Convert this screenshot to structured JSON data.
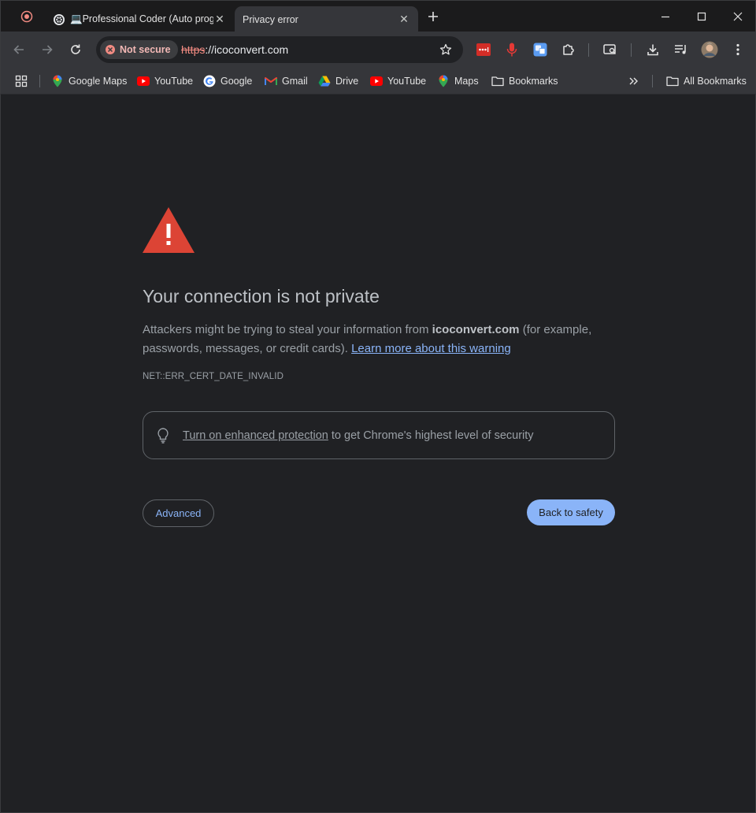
{
  "tabs": [
    {
      "title": "💻Professional Coder (Auto programming)",
      "favicon": "chatgpt-icon",
      "active": false
    },
    {
      "title": "Privacy error",
      "favicon": "",
      "active": true
    }
  ],
  "omnibox": {
    "security_chip": "Not secure",
    "url_scheme": "https",
    "url_rest": "://icoconvert.com"
  },
  "bookmarks": [
    {
      "label": "Google Maps",
      "icon": "maps-pin-icon"
    },
    {
      "label": "YouTube",
      "icon": "youtube-icon"
    },
    {
      "label": "Google",
      "icon": "google-icon"
    },
    {
      "label": "Gmail",
      "icon": "gmail-icon"
    },
    {
      "label": "Drive",
      "icon": "drive-icon"
    },
    {
      "label": "YouTube",
      "icon": "youtube-icon"
    },
    {
      "label": "Maps",
      "icon": "maps-pin-icon"
    },
    {
      "label": "Bookmarks",
      "icon": "folder-icon"
    }
  ],
  "all_bookmarks_label": "All Bookmarks",
  "page": {
    "title": "Your connection is not private",
    "desc_before": "Attackers might be trying to steal your information from ",
    "desc_domain": "icoconvert.com",
    "desc_after": " (for example, passwords, messages, or credit cards). ",
    "learn_more": "Learn more about this warning",
    "error_code": "NET::ERR_CERT_DATE_INVALID",
    "promo_link": "Turn on enhanced protection",
    "promo_text": " to get Chrome's highest level of security",
    "advanced_label": "Advanced",
    "back_label": "Back to safety"
  },
  "colors": {
    "warning_red": "#dc4435",
    "link_blue": "#8ab4f8",
    "page_bg": "#202124"
  }
}
